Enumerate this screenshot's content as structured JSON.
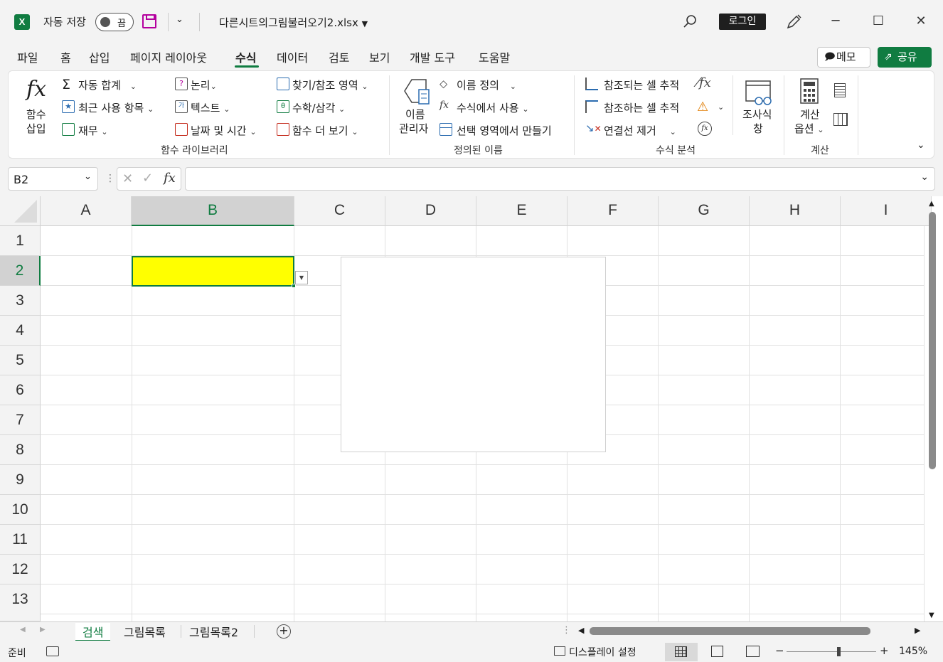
{
  "titlebar": {
    "autosave_label": "자동 저장",
    "autosave_state": "끔",
    "filename": "다른시트의그림불러오기2.xlsx",
    "login_label": "로그인"
  },
  "menu": {
    "tabs": [
      "파일",
      "홈",
      "삽입",
      "페이지 레이아웃",
      "수식",
      "데이터",
      "검토",
      "보기",
      "개발 도구",
      "도움말"
    ],
    "active_tab": "수식",
    "memo_label": "메모",
    "share_label": "공유"
  },
  "ribbon": {
    "insert_function": [
      "함수",
      "삽입"
    ],
    "autosum": "자동 합계",
    "recent": "최근 사용 항목",
    "finance": "재무",
    "logical": "논리",
    "text": "텍스트",
    "datetime": "날짜 및 시간",
    "lookup": "찾기/참조 영역",
    "math": "수학/삼각",
    "more_functions": "함수 더 보기",
    "group_function_library": "함수 라이브러리",
    "name_manager": [
      "이름",
      "관리자"
    ],
    "define_name": "이름 정의",
    "use_in_formula": "수식에서 사용",
    "create_from_selection": "선택 영역에서 만들기",
    "group_defined_names": "정의된 이름",
    "trace_precedents": "참조되는 셀 추적",
    "trace_dependents": "참조하는 셀 추적",
    "remove_arrows": "연결선 제거",
    "watch_window": [
      "조사식",
      "창"
    ],
    "group_formula_auditing": "수식 분석",
    "calc_options": [
      "계산",
      "옵션"
    ],
    "group_calculation": "계산"
  },
  "formula_bar": {
    "name_box": "B2",
    "formula": ""
  },
  "grid": {
    "columns": [
      "A",
      "B",
      "C",
      "D",
      "E",
      "F",
      "G",
      "H",
      "I"
    ],
    "rows": [
      "1",
      "2",
      "3",
      "4",
      "5",
      "6",
      "7",
      "8",
      "9",
      "10",
      "11",
      "12",
      "13"
    ],
    "selected_cell": "B2",
    "selected_fill": "#ffff00"
  },
  "sheets": {
    "tabs": [
      "검색",
      "그림목록",
      "그림목록2"
    ],
    "active": "검색"
  },
  "statusbar": {
    "ready": "준비",
    "display_settings": "디스플레이 설정",
    "zoom": "145%"
  },
  "colors": {
    "accent": "#107c41"
  }
}
